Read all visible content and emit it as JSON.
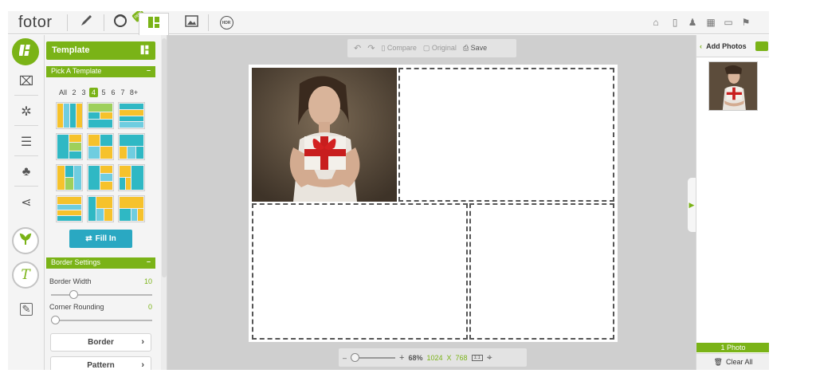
{
  "app": {
    "logo": "fotor",
    "new_badge": "new",
    "tabs": [
      {
        "icon": "brush-icon"
      },
      {
        "icon": "beauty-face-icon"
      },
      {
        "icon": "collage-icon"
      },
      {
        "icon": "image-icon"
      },
      {
        "icon": "hdr-icon",
        "label": "HDR"
      }
    ],
    "platforms": [
      "home-icon",
      "ios-icon",
      "android-icon",
      "windows-icon",
      "desktop-icon",
      "windows-store-icon"
    ]
  },
  "rail": {
    "items": [
      "collage-icon",
      "frame-icon",
      "butterfly-icon",
      "list-icon",
      "people-icon",
      "share-icon",
      "leaf-icon",
      "text-icon",
      "edit-icon"
    ]
  },
  "panel": {
    "title": "Template",
    "pick_title": "Pick A Template",
    "collapse": "–",
    "counts": [
      "All",
      "2",
      "3",
      "4",
      "5",
      "6",
      "7",
      "8+"
    ],
    "selected_count": "4",
    "fill_in": "Fill In",
    "border_title": "Border Settings",
    "border_width_label": "Border Width",
    "border_width_value": "10",
    "corner_label": "Corner Rounding",
    "corner_value": "0",
    "border_button": "Border",
    "pattern_button": "Pattern",
    "chevron": "›"
  },
  "toolbar": {
    "compare": "Compare",
    "original": "Original",
    "save": "Save"
  },
  "zoom": {
    "minus": "–",
    "plus": "+",
    "percent": "68%",
    "width": "1024",
    "x": "X",
    "height": "768",
    "level": 0.0
  },
  "right": {
    "add_photos": "Add Photos",
    "arrow": "‹",
    "photo_count": "1 Photo",
    "clear_all": "Clear All"
  },
  "colors": {
    "accent": "#7ab317",
    "teal": "#2aa8c2",
    "yellow": "#f6c22c"
  }
}
